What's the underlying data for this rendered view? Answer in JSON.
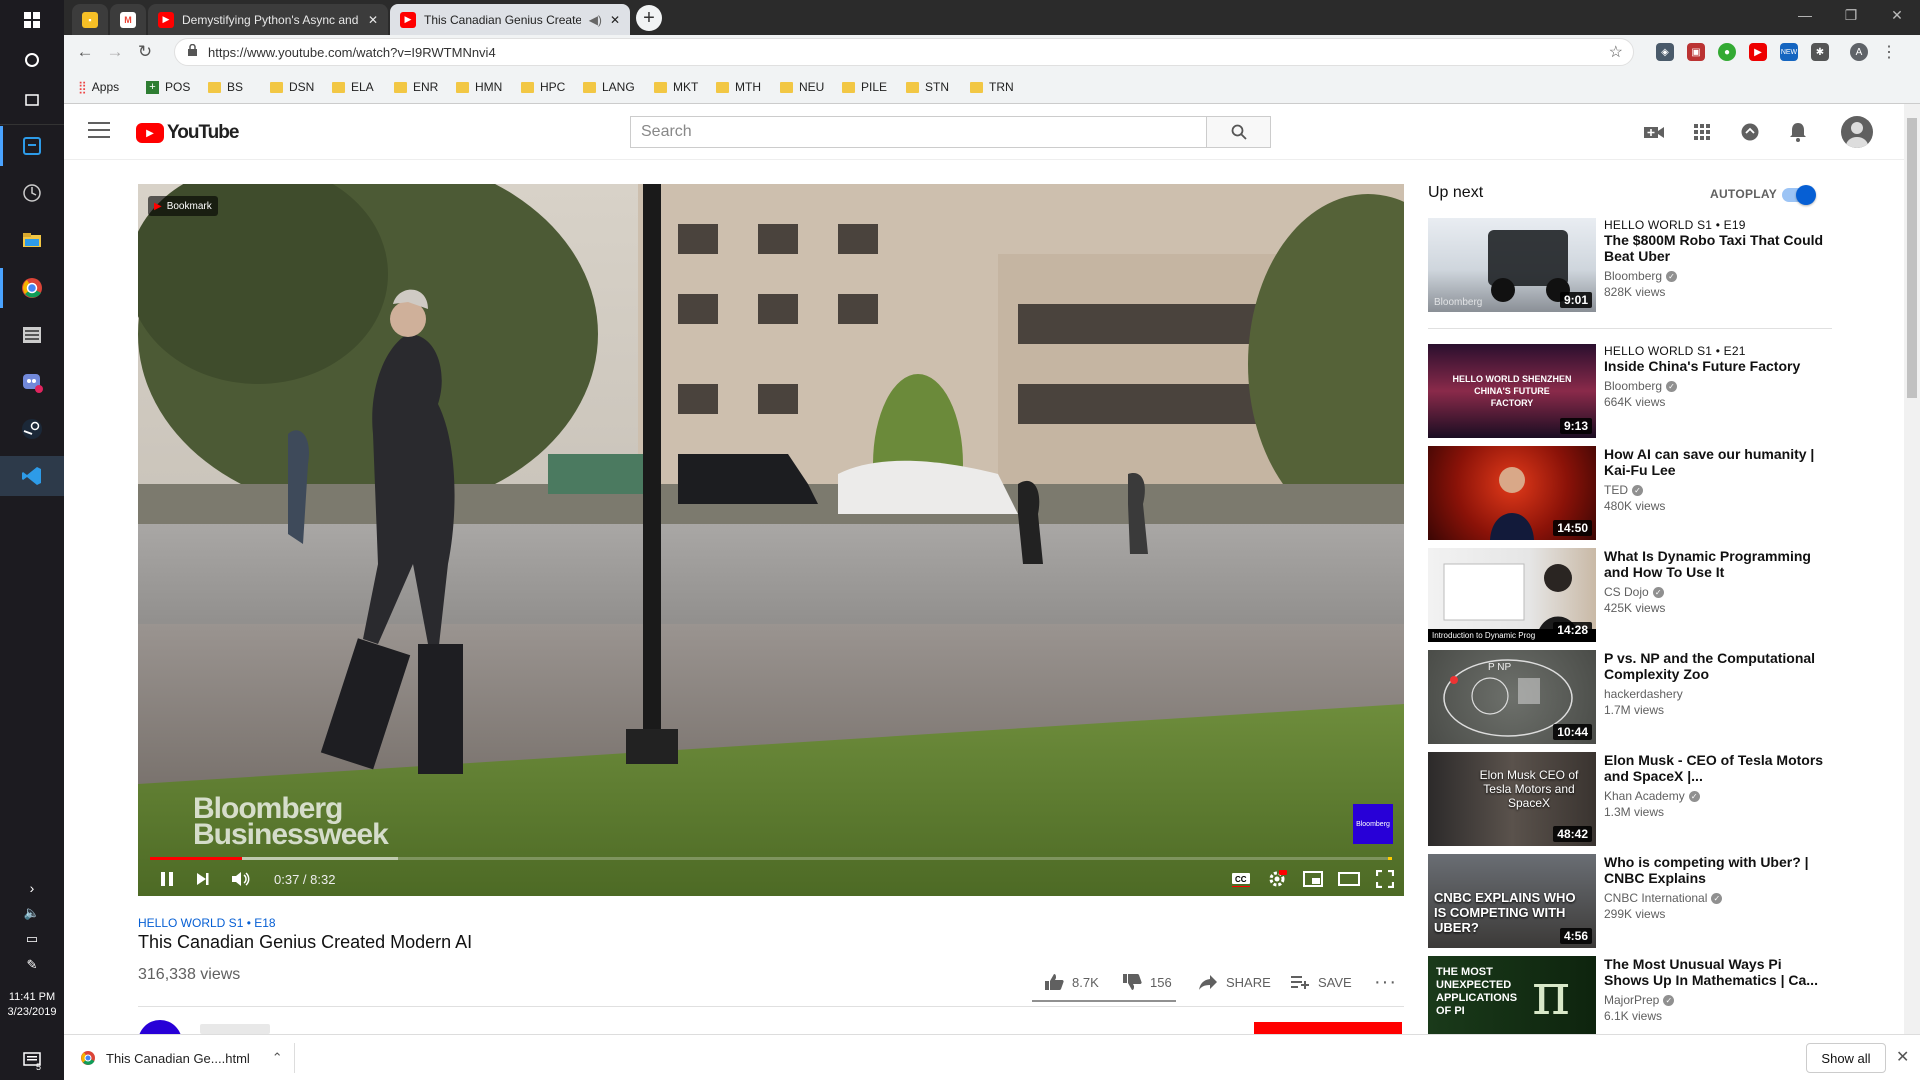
{
  "taskbar": {
    "time": "11:41 PM",
    "date": "3/23/2019",
    "notification_count": "5"
  },
  "browser": {
    "tabs": [
      {
        "title": "",
        "favicon": "keep-icon",
        "color": "#f6bf26"
      },
      {
        "title": "",
        "favicon": "gmail-icon",
        "color": "#ea4335"
      },
      {
        "title": "Demystifying Python's Async and",
        "favicon": "youtube-icon",
        "color": "#ff0000"
      },
      {
        "title": "This Canadian Genius Create",
        "favicon": "youtube-icon",
        "color": "#ff0000"
      }
    ],
    "url": "https://www.youtube.com/watch?v=I9RWTMNnvi4",
    "bookmarks": [
      "Apps",
      "POS",
      "BS",
      "DSN",
      "ELA",
      "ENR",
      "HMN",
      "HPC",
      "LANG",
      "MKT",
      "MTH",
      "NEU",
      "PILE",
      "STN",
      "TRN"
    ]
  },
  "youtube": {
    "logo_text": "YouTube",
    "search_placeholder": "Search",
    "player": {
      "bookmark_label": "Bookmark",
      "time": "0:37 / 8:32",
      "played_fraction": 0.074,
      "buffered_fraction": 0.2,
      "watermark": [
        "Bloomberg",
        "Businessweek"
      ],
      "corner_logo": "Bloomberg"
    },
    "video": {
      "tag": "HELLO WORLD  S1 • E18",
      "title": "This Canadian Genius Created Modern AI",
      "views": "316,338 views",
      "likes": "8.7K",
      "dislikes": "156",
      "share": "SHARE",
      "save": "SAVE"
    },
    "up_next_label": "Up next",
    "autoplay_label": "AUTOPLAY",
    "autoplay_on": true,
    "recommendations": [
      {
        "tag": "HELLO WORLD  S1 • E19",
        "title": "The $800M Robo Taxi That Could Beat Uber",
        "channel": "Bloomberg",
        "views": "828K views",
        "duration": "9:01",
        "thumb_text": "Bloomberg"
      },
      {
        "tag": "HELLO WORLD  S1 • E21",
        "title": "Inside China's Future Factory",
        "channel": "Bloomberg",
        "views": "664K views",
        "duration": "9:13",
        "thumb_text": "HELLO WORLD SHENZHEN CHINA'S FUTURE FACTORY"
      },
      {
        "tag": "",
        "title": "How AI can save our humanity | Kai-Fu Lee",
        "channel": "TED",
        "views": "480K views",
        "duration": "14:50",
        "thumb_text": ""
      },
      {
        "tag": "",
        "title": "What Is Dynamic Programming and How To Use It",
        "channel": "CS Dojo",
        "views": "425K views",
        "duration": "14:28",
        "thumb_text": "Introduction to Dynamic Prog"
      },
      {
        "tag": "",
        "title": "P vs. NP and the Computational Complexity Zoo",
        "channel": "hackerdashery",
        "views": "1.7M views",
        "duration": "10:44",
        "thumb_text": "P  NP"
      },
      {
        "tag": "",
        "title": "Elon Musk - CEO of Tesla Motors and SpaceX |...",
        "channel": "Khan Academy",
        "views": "1.3M views",
        "duration": "48:42",
        "thumb_text": "Elon Musk CEO of Tesla Motors and SpaceX"
      },
      {
        "tag": "",
        "title": "Who is competing with Uber? | CNBC Explains",
        "channel": "CNBC International",
        "views": "299K views",
        "duration": "4:56",
        "thumb_text": "CNBC EXPLAINS WHO IS COMPETING WITH UBER?"
      },
      {
        "tag": "",
        "title": "The Most Unusual Ways Pi Shows Up In Mathematics | Ca...",
        "channel": "MajorPrep",
        "views": "6.1K views",
        "duration": "",
        "thumb_text": "THE MOST UNEXPECTED APPLICATIONS OF PI"
      }
    ]
  },
  "downloads": {
    "file": "This Canadian Ge....html",
    "show_all": "Show all"
  }
}
